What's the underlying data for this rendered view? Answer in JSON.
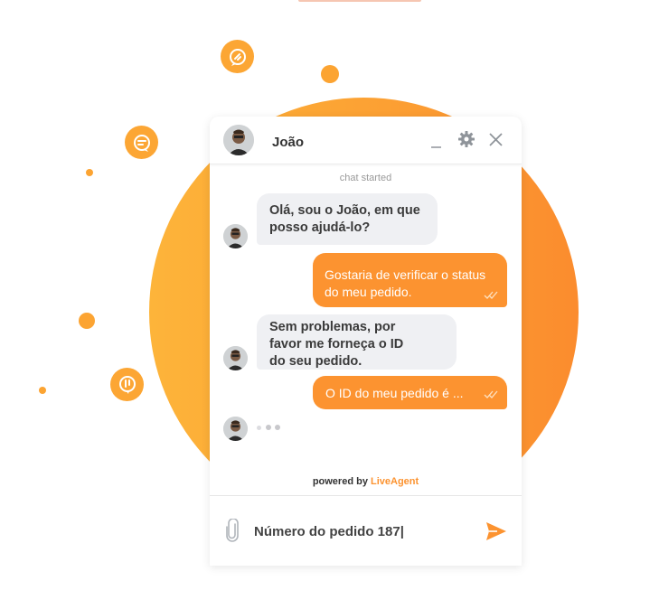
{
  "colors": {
    "accent": "#fc9330",
    "circle_gradient_start": "#fdb43a",
    "circle_gradient_end": "#fb8c2e",
    "agent_bubble": "#eff0f3",
    "header_icon": "#8f949a"
  },
  "decor": {
    "icons": [
      "chat-bubble-icon",
      "chat-bubble-icon",
      "chat-bubble-icon"
    ]
  },
  "chat": {
    "header": {
      "agent_name": "João",
      "avatar_icon": "agent-avatar",
      "buttons": {
        "minimize": "minimize-icon",
        "settings": "gear-icon",
        "close": "close-icon"
      }
    },
    "chat_started": "chat started",
    "messages": [
      {
        "from": "agent",
        "text": "Olá, sou o João, em que posso ajudá-lo?"
      },
      {
        "from": "visitor",
        "text": "Gostaria de verificar o status do meu pedido.",
        "status_icon": "double-check-icon"
      },
      {
        "from": "agent",
        "text": "Sem problemas, por favor me forneça o ID do seu pedido."
      },
      {
        "from": "visitor",
        "text": "O ID do meu pedido é ...",
        "status_icon": "double-check-icon"
      }
    ],
    "typing_indicator": "typing-dots",
    "powered_by": {
      "prefix": "powered by ",
      "brand": "LiveAgent"
    },
    "composer": {
      "value": "Número do pedido 187|",
      "attach_icon": "paperclip-icon",
      "send_icon": "send-icon"
    }
  }
}
